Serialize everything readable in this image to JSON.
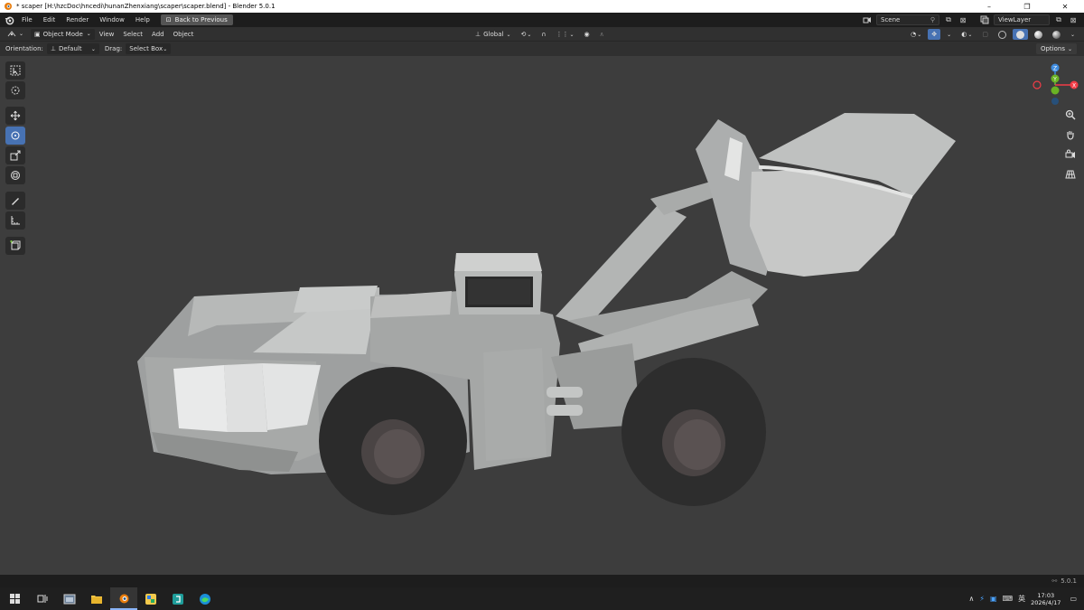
{
  "window": {
    "title": "* scaper [H:\\hzcDoc\\hncedi\\hunanZhenxiang\\scaper\\scaper.blend] - Blender 5.0.1",
    "minimize": "–",
    "maximize": "❐",
    "close": "✕"
  },
  "menubar": {
    "items": [
      "File",
      "Edit",
      "Render",
      "Window",
      "Help"
    ],
    "back_label": "Back to Previous",
    "scene_label": "Scene",
    "viewlayer_label": "ViewLayer"
  },
  "header": {
    "mode_label": "Object Mode",
    "menus": [
      "View",
      "Select",
      "Add",
      "Object"
    ],
    "transform_orientation": "Global"
  },
  "toolheader": {
    "orientation_label": "Orientation:",
    "orientation_value": "Default",
    "drag_label": "Drag:",
    "drag_value": "Select Box",
    "options_label": "Options"
  },
  "gizmo": {
    "x": "X",
    "y": "Y",
    "z": "Z"
  },
  "statusbar": {
    "version": "5.0.1"
  },
  "taskbar": {
    "time": "17:03",
    "date": "2026/4/17",
    "ime": "英"
  },
  "colors": {
    "accent": "#4772b3",
    "axis_x": "#f23c47",
    "axis_y": "#6ab324",
    "axis_z": "#3f8cdf",
    "viewport_bg": "#3d3d3d"
  }
}
